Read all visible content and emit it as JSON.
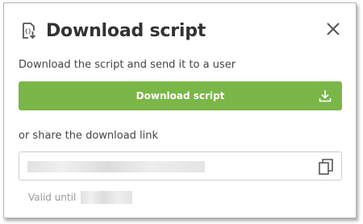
{
  "dialog": {
    "title": "Download script",
    "header_icon": "script-download-icon",
    "close_icon": "close-icon",
    "description": "Download the script and send it to a user",
    "download_button_label": "Download script",
    "download_button_icon": "download-icon",
    "share_label": "or share the download link",
    "link_value": "",
    "copy_icon": "copy-icon",
    "valid_until_label": "Valid until",
    "valid_until_value": ""
  },
  "colors": {
    "accent": "#7ab648",
    "text": "#333333",
    "muted": "#999999"
  }
}
